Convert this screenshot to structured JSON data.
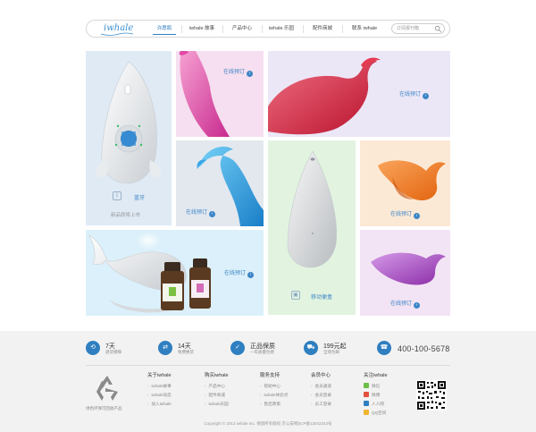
{
  "nav": {
    "logo": "iwhale",
    "items": [
      "许愿瓶",
      "iwhale 故事",
      "产品中心",
      "iwhale 乐园",
      "配件商城",
      "联系 iwhale"
    ],
    "search_placeholder": "订阅报刊箱"
  },
  "tiles": {
    "bluetooth_label": "蓝牙",
    "bluetooth_caption": "新品即将上市",
    "order_label": "在线预订",
    "arrow_glyph": "›",
    "portable_label": "移动便盒"
  },
  "features": [
    {
      "big": "7天",
      "small": "退货保障",
      "icon": "seven-day-icon"
    },
    {
      "big": "14天",
      "small": "免费换货",
      "icon": "exchange-icon"
    },
    {
      "big": "正品保质",
      "small": "一年质量包修",
      "icon": "quality-icon"
    },
    {
      "big": "199元起",
      "small": "全场包邮",
      "icon": "shopping-cart-icon"
    }
  ],
  "hotline": "400-100-5678",
  "footer": {
    "recycle_caption": "绿色环保可回收产品",
    "columns": [
      {
        "title": "关于iwhale",
        "links": [
          "iwhale故事",
          "iwhale动态",
          "加入iwhale"
        ]
      },
      {
        "title": "购买iwhale",
        "links": [
          "产品中心",
          "配件商城",
          "iwhale乐园"
        ]
      },
      {
        "title": "服务支持",
        "links": [
          "帮助中心",
          "iwhale体验点",
          "售后政策"
        ]
      },
      {
        "title": "会员中心",
        "links": [
          "会员通道",
          "会员登录",
          "员工登录"
        ]
      },
      {
        "title": "关注iwhale",
        "links": [
          "微信",
          "微博",
          "人人网",
          "QQ空间"
        ]
      }
    ],
    "copyright": "Copyright © 2013 iwhale Inc. 保留所有版权 京公安网(ICP备13042343号"
  },
  "colors": {
    "accent": "#2f7fc1",
    "strip_bg": "#f2f2f2"
  }
}
